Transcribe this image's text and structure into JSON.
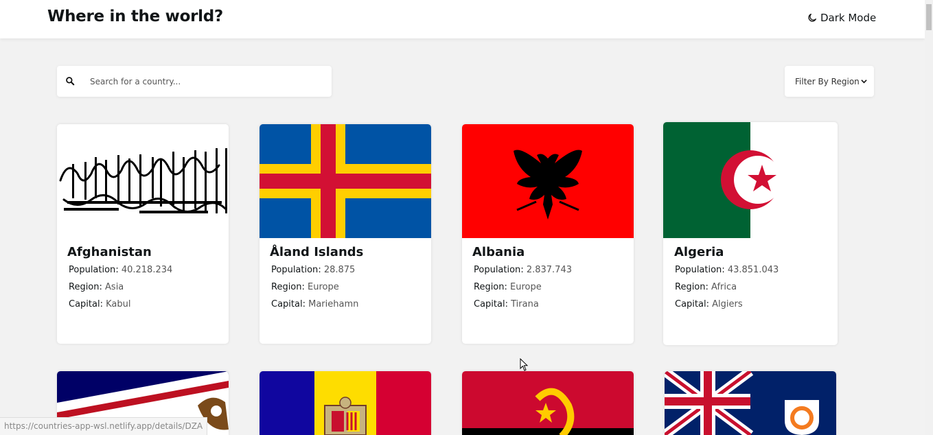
{
  "header": {
    "title": "Where in the world?",
    "dark_mode_label": "Dark Mode"
  },
  "search": {
    "placeholder": "Search for a country..."
  },
  "filter": {
    "label": "Filter By Region"
  },
  "labels": {
    "population": "Population",
    "region": "Region",
    "capital": "Capital"
  },
  "countries": [
    {
      "name": "Afghanistan",
      "population": "40.218.234",
      "region": "Asia",
      "capital": "Kabul"
    },
    {
      "name": "Åland Islands",
      "population": "28.875",
      "region": "Europe",
      "capital": "Mariehamn"
    },
    {
      "name": "Albania",
      "population": "2.837.743",
      "region": "Europe",
      "capital": "Tirana"
    },
    {
      "name": "Algeria",
      "population": "43.851.043",
      "region": "Africa",
      "capital": "Algiers"
    }
  ],
  "status_bar": {
    "url": "https://countries-app-wsl.netlify.app/details/DZA"
  },
  "colors": {
    "background": "#f2f2f2",
    "card": "#ffffff",
    "text": "#111517"
  }
}
